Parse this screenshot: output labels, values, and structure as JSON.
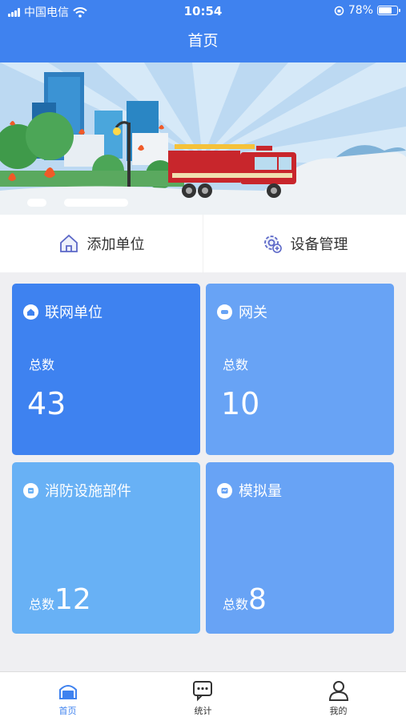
{
  "status_bar": {
    "carrier": "中国电信",
    "time": "10:54",
    "battery": "78%",
    "battery_level": 0.78
  },
  "nav": {
    "title": "首页"
  },
  "actions": [
    {
      "label": "添加单位",
      "icon": "home-icon"
    },
    {
      "label": "设备管理",
      "icon": "gear-icon"
    }
  ],
  "cards": [
    {
      "title": "联网单位",
      "sub": "总数",
      "value": "43",
      "color": "#3e82f0"
    },
    {
      "title": "网关",
      "sub": "总数",
      "value": "10",
      "color": "#68a3f5"
    },
    {
      "title": "消防设施部件",
      "sub": "总数",
      "value": "12",
      "color": "#68b1f5"
    },
    {
      "title": "模拟量",
      "sub": "总数",
      "value": "8",
      "color": "#68a3f5"
    }
  ],
  "tabs": [
    {
      "label": "首页",
      "active": true
    },
    {
      "label": "统计",
      "active": false
    },
    {
      "label": "我的",
      "active": false
    }
  ]
}
